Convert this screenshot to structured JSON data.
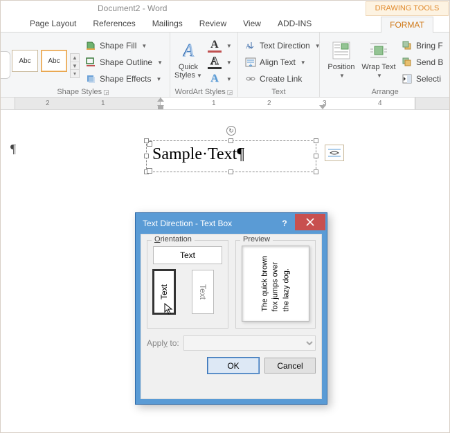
{
  "title": "Document2 - Word",
  "contextual_title": "DRAWING TOOLS",
  "tabs": {
    "page_layout": "Page Layout",
    "references": "References",
    "mailings": "Mailings",
    "review": "Review",
    "view": "View",
    "addins": "ADD-INS",
    "format": "FORMAT"
  },
  "ribbon": {
    "shape_styles": {
      "label": "Shape Styles",
      "abc": "Abc",
      "shape_fill": "Shape Fill",
      "shape_outline": "Shape Outline",
      "shape_effects": "Shape Effects"
    },
    "wordart_styles": {
      "label": "WordArt Styles",
      "quick_styles": "Quick Styles"
    },
    "text": {
      "label": "Text",
      "text_direction": "Text Direction",
      "align_text": "Align Text",
      "create_link": "Create Link"
    },
    "arrange": {
      "label": "Arrange",
      "position": "Position",
      "wrap_text": "Wrap Text",
      "bring_forward": "Bring F",
      "send_backward": "Send B",
      "selection_pane": "Selecti"
    }
  },
  "ruler_ticks": [
    "2",
    "1",
    "1",
    "2",
    "3",
    "4"
  ],
  "document": {
    "textbox_content": "Sample·Text¶"
  },
  "dialog": {
    "title": "Text Direction - Text Box",
    "orientation_label_pre": "O",
    "orientation_label_post": "rientation",
    "preview_label": "Preview",
    "opt_h": "Text",
    "opt_v1": "Text",
    "opt_v2": "Text",
    "preview_line1": "The quick brown",
    "preview_line2": "fox jumps over",
    "preview_line3": "the lazy dog.",
    "apply_pre": "Appl",
    "apply_u": "y",
    "apply_post": " to:",
    "ok": "OK",
    "cancel": "Cancel"
  }
}
